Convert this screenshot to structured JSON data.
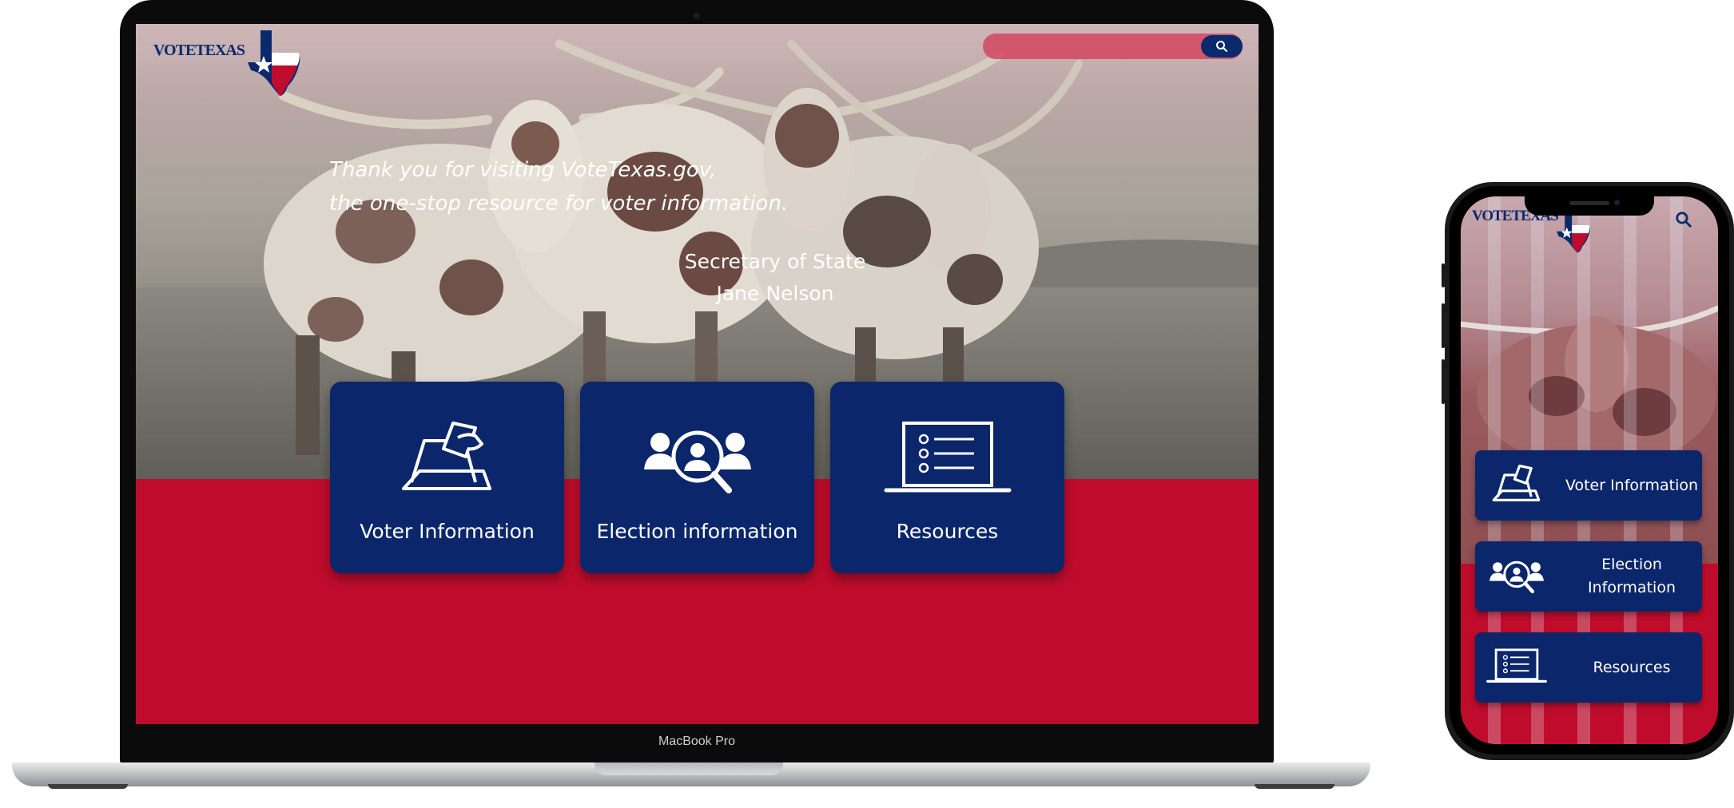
{
  "laptop": {
    "device_label": "MacBook Pro",
    "logo_text": "VOTETEXAS",
    "hero": {
      "line1": "Thank you for visiting VoteTexas.gov,",
      "line2": "the one-stop resource for voter information.",
      "sign_title": "Secretary of State",
      "sign_name": "Jane Nelson"
    },
    "cards": [
      {
        "label": "Voter Information",
        "icon": "ballot-box-icon"
      },
      {
        "label": "Election information",
        "icon": "people-search-icon"
      },
      {
        "label": "Resources",
        "icon": "laptop-checklist-icon"
      }
    ]
  },
  "phone": {
    "logo_text": "VOTETEXAS",
    "cards": [
      {
        "label": "Voter Information",
        "icon": "ballot-box-icon"
      },
      {
        "label": "Election Information",
        "icon": "people-search-icon"
      },
      {
        "label": "Resources",
        "icon": "laptop-checklist-icon"
      }
    ]
  },
  "colors": {
    "navy": "#0b266a",
    "red": "#c00c2c",
    "logo_blue": "#0a2a6d"
  }
}
